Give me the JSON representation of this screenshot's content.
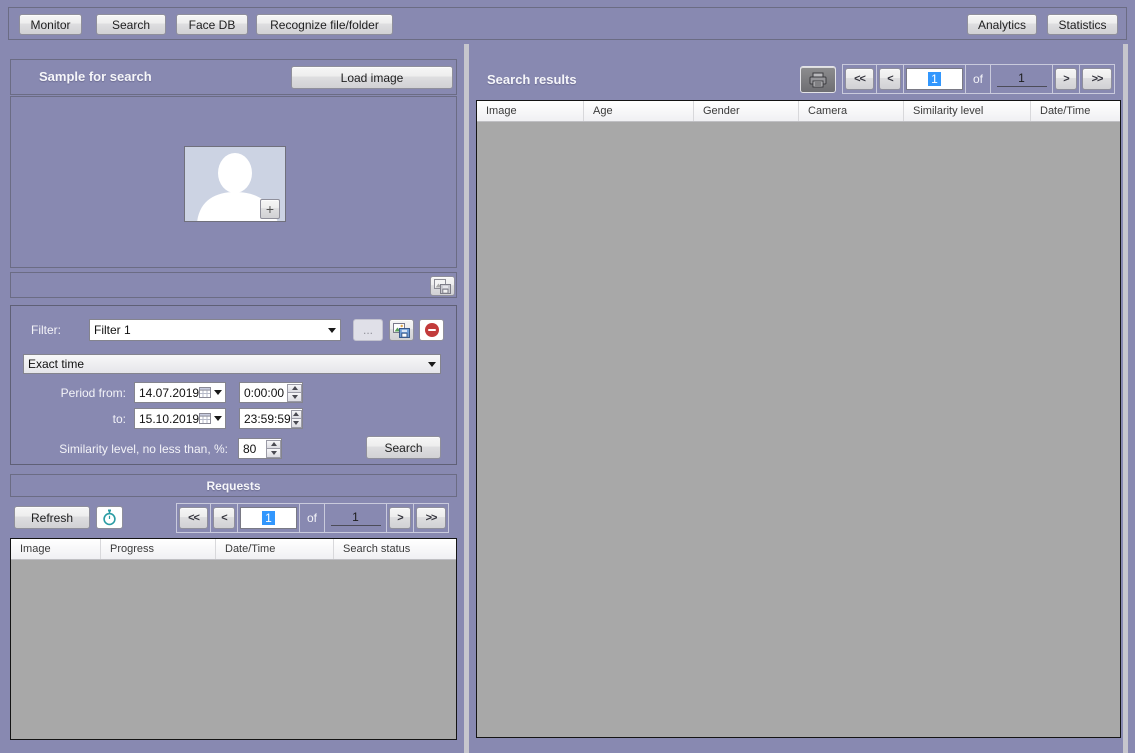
{
  "colors": {
    "background": "#8889b1",
    "selection_blue": "#3297fd",
    "table_body_gray": "#a8a8a8",
    "remove_red": "#c23b3b",
    "timer_teal": "#2a9ca4"
  },
  "toolbar": {
    "monitor": "Monitor",
    "search": "Search",
    "face_db": "Face DB",
    "recognize": "Recognize file/folder",
    "analytics": "Analytics",
    "statistics": "Statistics"
  },
  "sample": {
    "title": "Sample for search",
    "load_image": "Load image",
    "add_sample": "+"
  },
  "filter": {
    "label": "Filter:",
    "selected": "Filter 1",
    "browse": "...",
    "time_mode": "Exact time",
    "period_from_label": "Period from:",
    "from_date": "14.07.2019",
    "from_time": "0:00:00",
    "to_label": "to:",
    "to_date": "15.10.2019",
    "to_time": "23:59:59",
    "similarity_label": "Similarity level, no less than, %:",
    "similarity_value": "80",
    "search_button": "Search"
  },
  "requests": {
    "title": "Requests",
    "refresh": "Refresh",
    "pager": {
      "first": "<<",
      "prev": "<",
      "page": "1",
      "of_label": "of",
      "total": "1",
      "next": ">",
      "last": ">>"
    },
    "columns": [
      "Image",
      "Progress",
      "Date/Time",
      "Search status"
    ]
  },
  "results": {
    "title": "Search results",
    "pager": {
      "first": "<<",
      "prev": "<",
      "page": "1",
      "of_label": "of",
      "total": "1",
      "next": ">",
      "last": ">>"
    },
    "columns": [
      "Image",
      "Age",
      "Gender",
      "Camera",
      "Similarity level",
      "Date/Time"
    ]
  }
}
